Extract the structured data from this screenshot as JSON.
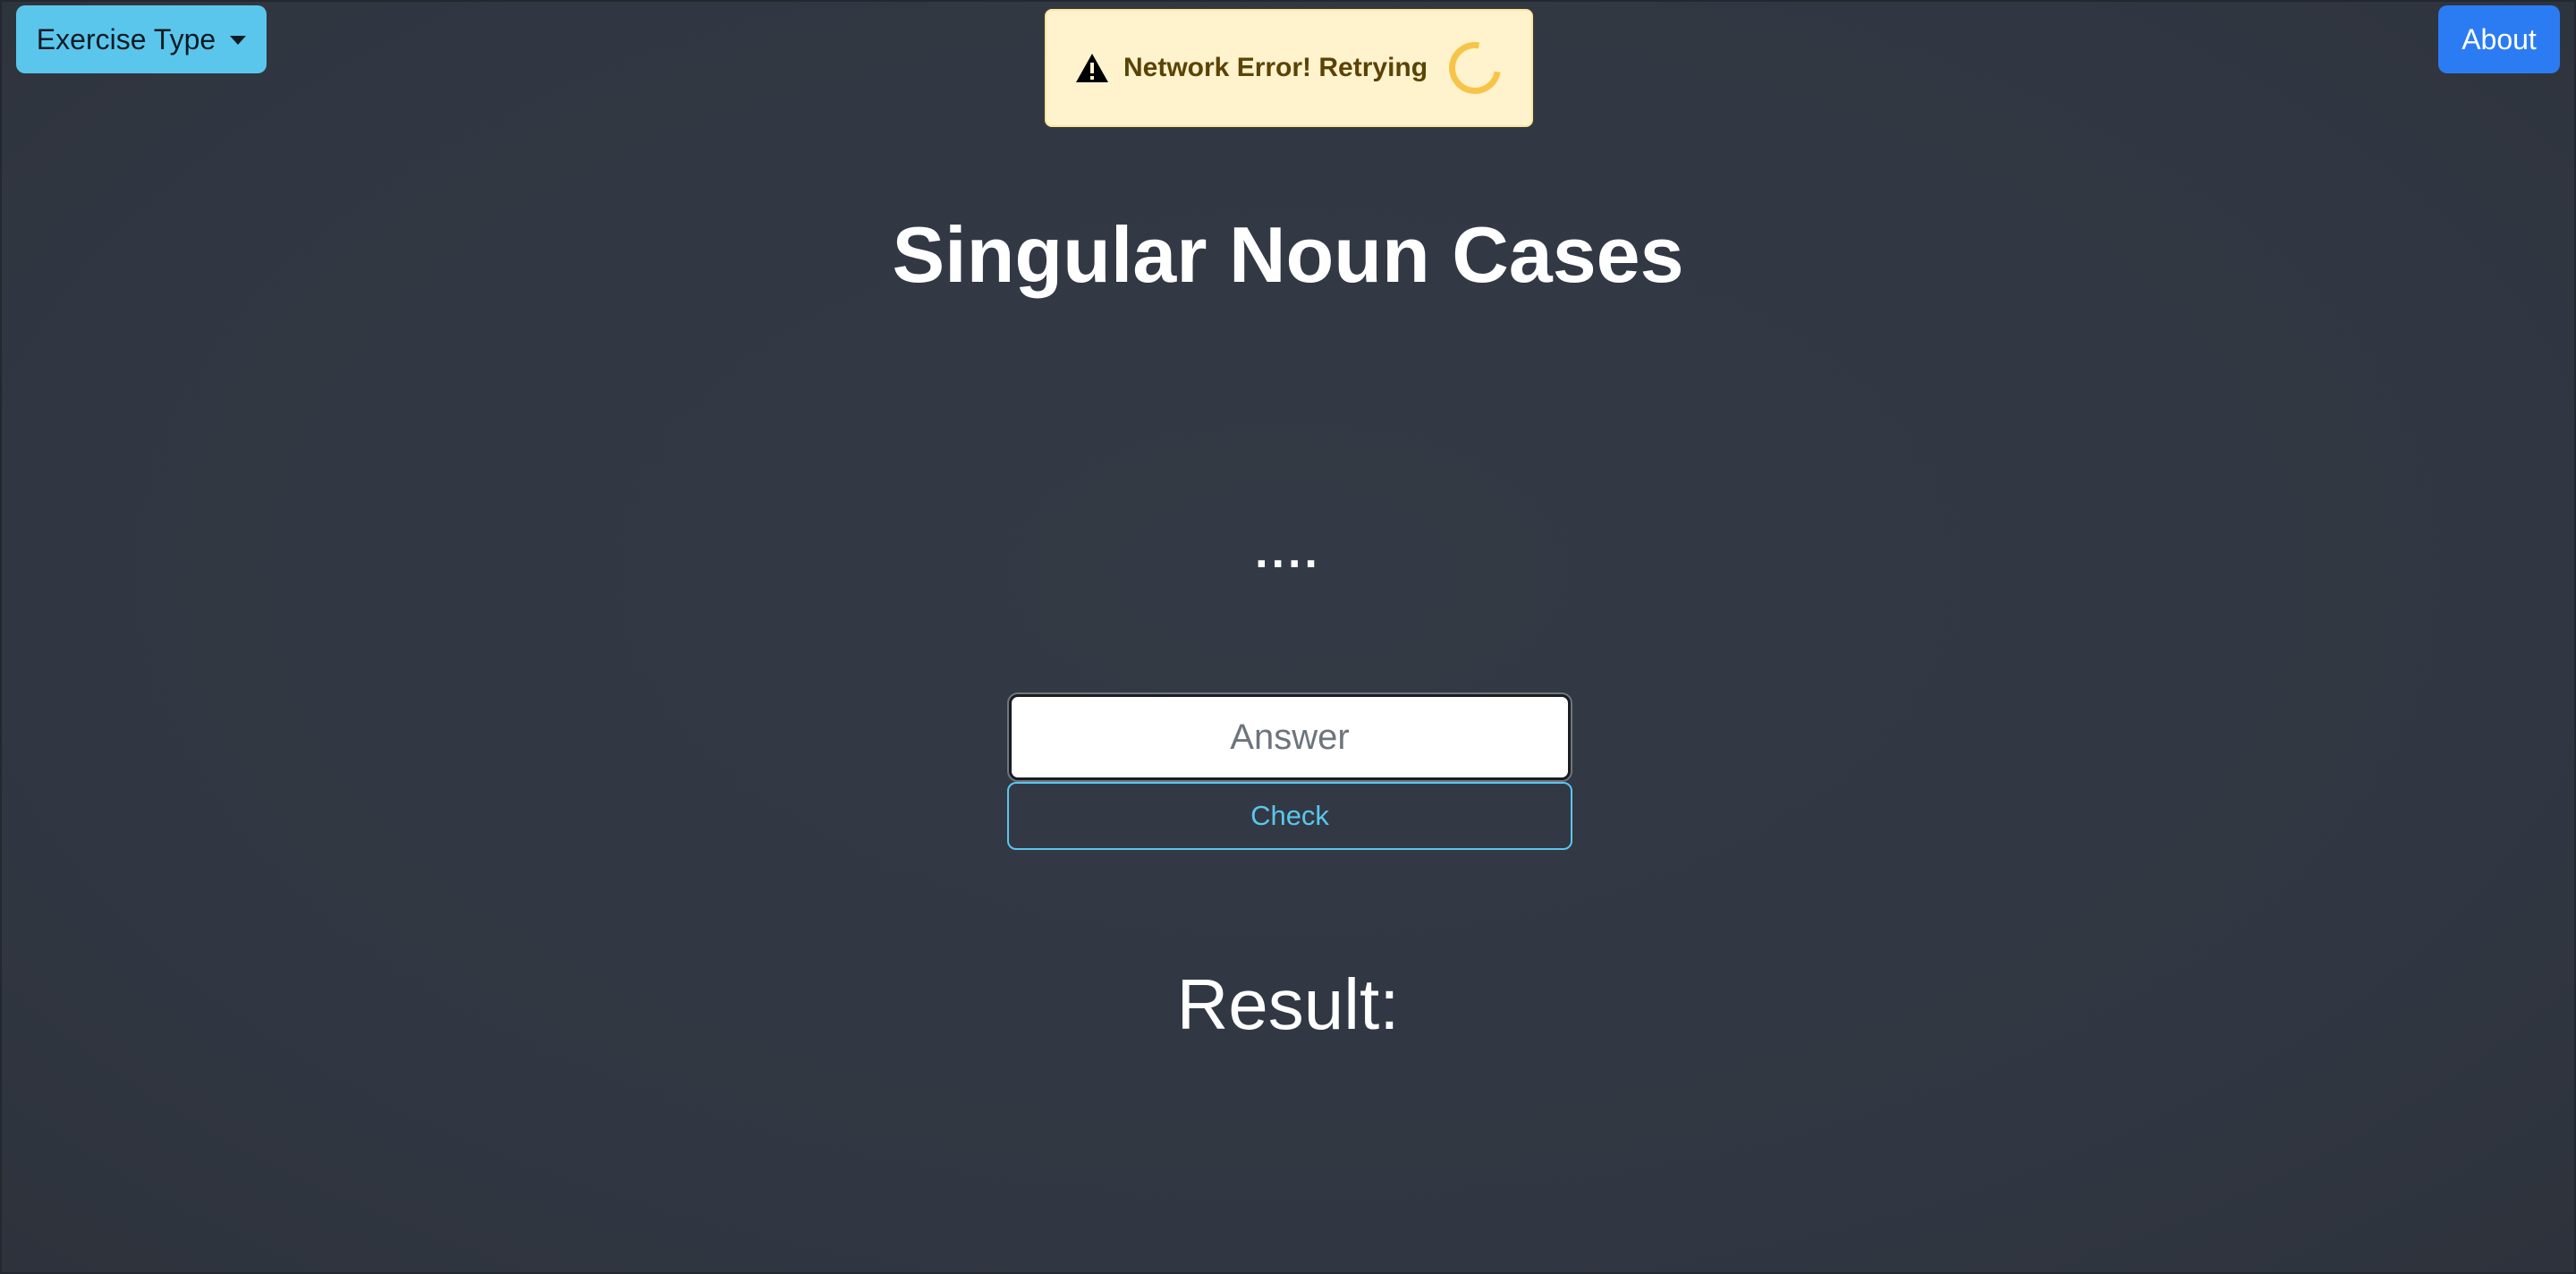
{
  "header": {
    "exercise_type_label": "Exercise Type",
    "about_label": "About"
  },
  "toast": {
    "message": "Network Error! Retrying",
    "icon": "warning-icon",
    "spinner_icon": "loading-spinner-icon"
  },
  "main": {
    "title": "Singular Noun Cases",
    "prompt": "....",
    "answer_placeholder": "Answer",
    "answer_value": "",
    "check_label": "Check",
    "result_label": "Result:"
  },
  "colors": {
    "background": "#323843",
    "dropdown": "#5bc6ec",
    "about": "#2b7cf2",
    "toast_bg": "#fff3cd",
    "toast_text": "#5b4306",
    "spinner": "#f7c44a",
    "check_outline": "#5bc6ec"
  }
}
